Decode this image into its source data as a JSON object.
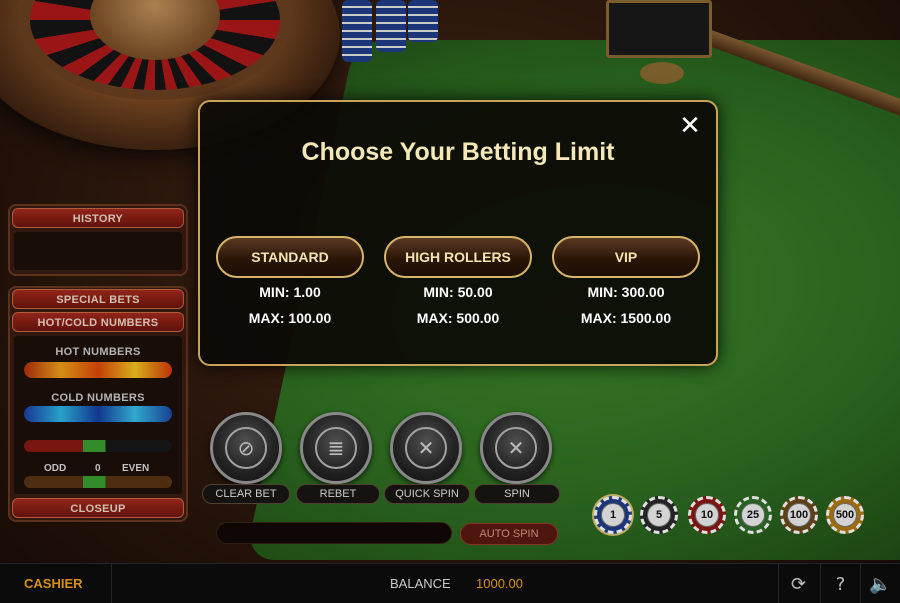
{
  "modal": {
    "title": "Choose Your Betting Limit",
    "close_icon": "close-icon",
    "options": [
      {
        "label": "STANDARD",
        "min": "MIN: 1.00",
        "max": "MAX: 100.00"
      },
      {
        "label": "HIGH ROLLERS",
        "min": "MIN: 50.00",
        "max": "MAX: 500.00"
      },
      {
        "label": "VIP",
        "min": "MIN: 300.00",
        "max": "MAX: 1500.00"
      }
    ]
  },
  "left_panel": {
    "history_label": "HISTORY",
    "special_bets_label": "SPECIAL BETS",
    "hot_cold_label": "HOT/COLD NUMBERS",
    "hot_numbers_label": "HOT NUMBERS",
    "cold_numbers_label": "COLD NUMBERS",
    "odd_label": "ODD",
    "zero_label": "0",
    "even_label": "EVEN",
    "closeup_label": "CLOSEUP"
  },
  "actions": {
    "clear_bet": "CLEAR BET",
    "rebet": "REBET",
    "quick_spin": "QUICK SPIN",
    "spin": "SPIN",
    "auto_spin": "AUTO SPIN"
  },
  "chips": [
    {
      "value": "1",
      "color": "#1f3f8a"
    },
    {
      "value": "5",
      "color": "#2a2a2a"
    },
    {
      "value": "10",
      "color": "#8a1a14"
    },
    {
      "value": "25",
      "color": "#2f6e2a"
    },
    {
      "value": "100",
      "color": "#6a4a1a"
    },
    {
      "value": "500",
      "color": "#b07a12"
    }
  ],
  "bottom_bar": {
    "cashier_label": "CASHIER",
    "balance_label": "BALANCE",
    "balance_value": "1000.00",
    "icons": [
      "refresh-icon",
      "help-icon",
      "sound-icon"
    ]
  },
  "colors": {
    "accent_gold": "#f2a51a",
    "modal_border": "#c9a35a",
    "felt_green": "#2f6f22"
  }
}
